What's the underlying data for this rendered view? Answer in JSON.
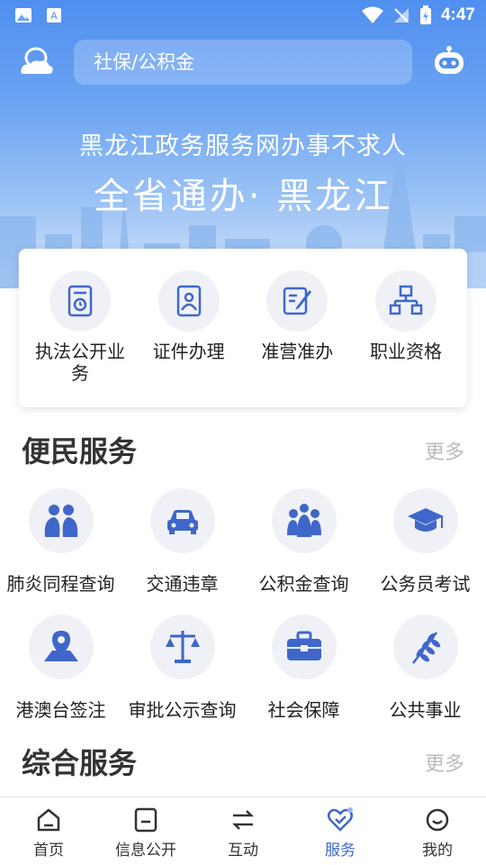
{
  "status": {
    "time": "4:47"
  },
  "search": {
    "placeholder": "社保/公积金"
  },
  "banner": {
    "line1": "黑龙江政务服务网办事不求人",
    "line2": "全省通办· 黑龙江"
  },
  "top_services": [
    {
      "label": "执法公开业务",
      "icon": "document-icon"
    },
    {
      "label": "证件办理",
      "icon": "id-card-icon"
    },
    {
      "label": "准营准办",
      "icon": "edit-icon"
    },
    {
      "label": "职业资格",
      "icon": "org-chart-icon"
    }
  ],
  "sections": {
    "convenience": {
      "title": "便民服务",
      "more": "更多"
    },
    "comprehensive": {
      "title": "综合服务",
      "more": "更多"
    }
  },
  "convenience_items": [
    {
      "label": "肺炎同程查询",
      "icon": "lungs-icon"
    },
    {
      "label": "交通违章",
      "icon": "car-icon"
    },
    {
      "label": "公积金查询",
      "icon": "people-icon"
    },
    {
      "label": "公务员考试",
      "icon": "graduation-cap-icon"
    },
    {
      "label": "港澳台签注",
      "icon": "map-pin-icon"
    },
    {
      "label": "审批公示查询",
      "icon": "scales-icon"
    },
    {
      "label": "社会保障",
      "icon": "toolbox-icon"
    },
    {
      "label": "公共事业",
      "icon": "wheat-icon"
    }
  ],
  "nav": [
    {
      "label": "首页",
      "icon": "home-icon"
    },
    {
      "label": "信息公开",
      "icon": "info-icon"
    },
    {
      "label": "互动",
      "icon": "exchange-icon"
    },
    {
      "label": "服务",
      "icon": "heart-check-icon"
    },
    {
      "label": "我的",
      "icon": "smile-icon"
    }
  ],
  "colors": {
    "accent": "#3f67c9",
    "banner": "#4f8ff0",
    "icon_bg": "#eff1f6"
  }
}
